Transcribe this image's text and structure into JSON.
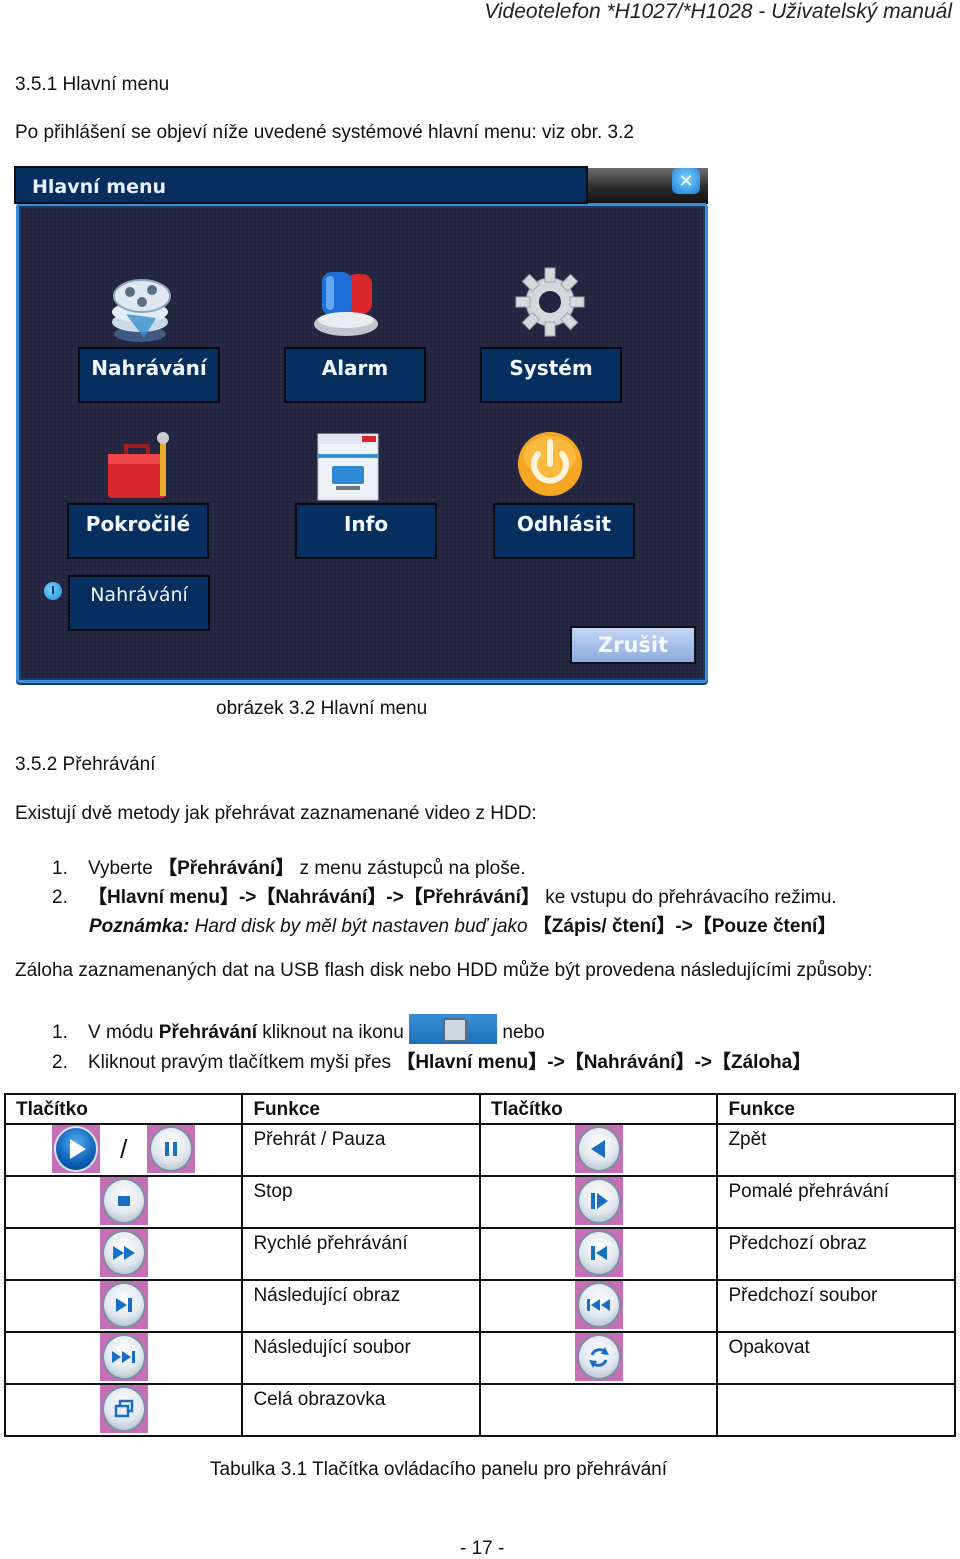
{
  "header": {
    "title": "Videotelefon *H1027/*H1028 - Uživatelský manuál"
  },
  "section_1": {
    "heading": "3.5.1  Hlavní menu",
    "intro": "Po přihlášení se objeví níže uvedené systémové hlavní menu: viz obr. 3.2"
  },
  "dialog": {
    "title": "Hlavní menu",
    "close_icon": "close-icon",
    "buttons": [
      {
        "label": "Nahrávání",
        "icon": "record-film-reel-icon"
      },
      {
        "label": "Alarm",
        "icon": "alarm-siren-icon"
      },
      {
        "label": "Systém",
        "icon": "gear-icon"
      },
      {
        "label": "Pokročilé",
        "icon": "toolbox-icon"
      },
      {
        "label": "Info",
        "icon": "info-window-icon"
      },
      {
        "label": "Odhlásit",
        "icon": "power-icon"
      }
    ],
    "status_button": "Nahrávání",
    "cancel_label": "Zrušit",
    "colors": {
      "button_bg": "#062e5e",
      "body_bg": "#232440",
      "frame": "#3a8fd8"
    }
  },
  "figure_caption": "obrázek 3.2 Hlavní menu",
  "section_2": {
    "heading": "3.5.2 Přehrávání",
    "intro": "Existují dvě metody jak přehrávat zaznamenané video z HDD:",
    "methods": [
      {
        "num": "1.",
        "pre": "Vyberte ",
        "bold": "【Přehrávání】",
        "post": " z menu zástupců na ploše."
      },
      {
        "num": "2.",
        "bold": "【Hlavní menu】->【Nahrávání】->【Přehrávání】",
        "post": "ke vstupu do přehrávacího režimu."
      }
    ],
    "note_label": "Poznámka:",
    "note_text": " Hard disk by měl být nastaven buď jako ",
    "note_bold": "【Zápis/ čtení】->【Pouze čtení】",
    "backup_intro": "Záloha zaznamenaných dat na USB flash disk nebo HDD může být provedena následujícími způsoby:",
    "backup_methods": [
      {
        "num": "1.",
        "pre": "V módu ",
        "bold": "Přehrávání",
        "post": " kliknout na ikonu ",
        "after_icon": " nebo"
      },
      {
        "num": "2.",
        "pre": "Kliknout pravým tlačítkem myši přes ",
        "bold": "【Hlavní menu】->【Nahrávání】->【Záloha】"
      }
    ]
  },
  "table": {
    "headers": [
      "Tlačítko",
      "Funkce",
      "Tlačítko",
      "Funkce"
    ],
    "rows": [
      {
        "left_icons": [
          "play",
          "pause"
        ],
        "left_sep": "/",
        "left_func": "Přehrát / Pauza",
        "right_icon": "back",
        "right_func": "Zpět"
      },
      {
        "left_icons": [
          "stop"
        ],
        "left_func": "Stop",
        "right_icon": "slow",
        "right_func": "Pomalé přehrávání"
      },
      {
        "left_icons": [
          "fast"
        ],
        "left_func": "Rychlé přehrávání",
        "right_icon": "prev-frame",
        "right_func": "Předchozí obraz"
      },
      {
        "left_icons": [
          "next-frame"
        ],
        "left_func": "Následující obraz",
        "right_icon": "prev-file",
        "right_func": "Předchozí soubor"
      },
      {
        "left_icons": [
          "next-file"
        ],
        "left_func": "Následující soubor",
        "right_icon": "repeat",
        "right_func": "Opakovat"
      },
      {
        "left_icons": [
          "fullscreen"
        ],
        "left_func": "Celá obrazovka",
        "right_icon": "",
        "right_func": ""
      }
    ],
    "caption": "Tabulka 3.1 Tlačítka ovládacího panelu pro přehrávání"
  },
  "footer": {
    "page_number": "- 17 -"
  }
}
